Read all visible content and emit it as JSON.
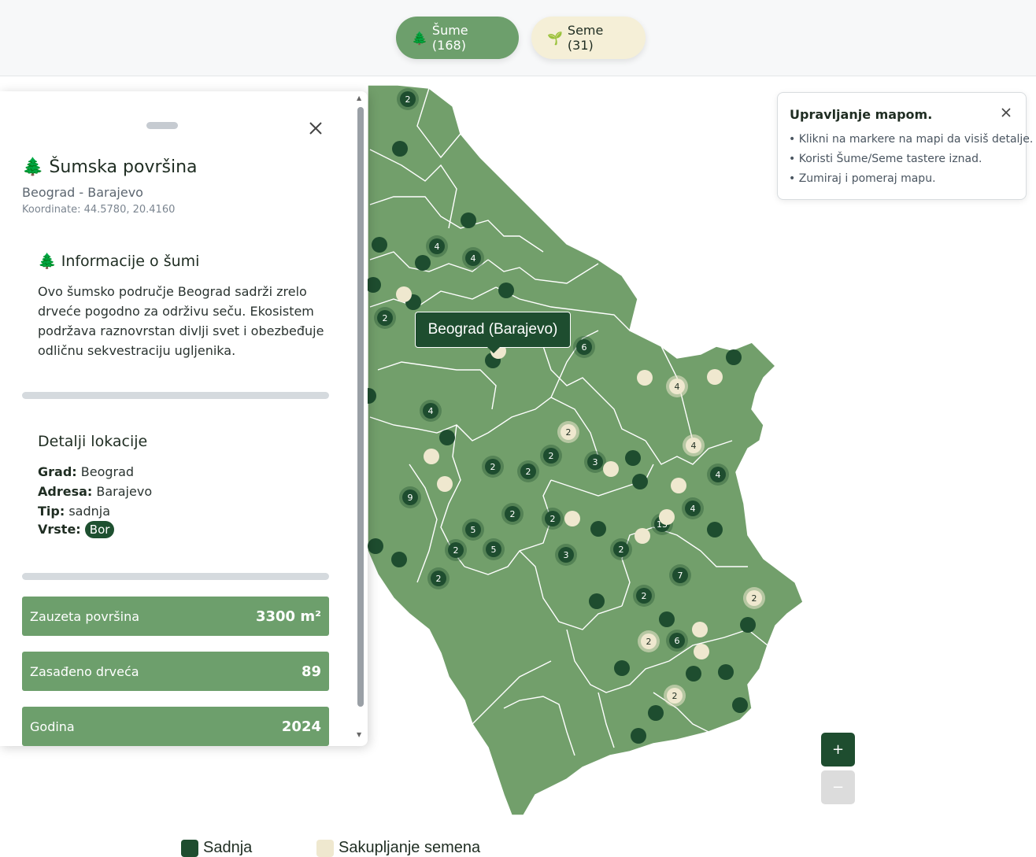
{
  "toolbar": {
    "forests": {
      "icon": "🌲",
      "label": "Šume (168)"
    },
    "seeds": {
      "icon": "🌱",
      "label": "Seme (31)"
    }
  },
  "panel": {
    "title_icon": "🌲",
    "title": "Šumska površina",
    "subtitle": "Beograd - Barajevo",
    "coordinates": "Koordinate: 44.5780, 20.4160",
    "info": {
      "icon": "🌲",
      "title": "Informacije o šumi",
      "text": "Ovo šumsko područje Beograd sadrži zrelo drveće pogodno za održivu seču. Ekosistem podržava raznovrstan divlji svet i obezbeđuje odličnu sekvestraciju ugljenika."
    },
    "location": {
      "title": "Detalji lokacije",
      "city_label": "Grad:",
      "city": "Beograd",
      "address_label": "Adresa:",
      "address": "Barajevo",
      "type_label": "Tip:",
      "type": "sadnja",
      "species_label": "Vrste:",
      "species": "Bor"
    },
    "stats": [
      {
        "label": "Zauzeta površina",
        "value": "3300 m²"
      },
      {
        "label": "Zasađeno drveća",
        "value": "89"
      },
      {
        "label": "Godina",
        "value": "2024"
      }
    ]
  },
  "tooltip": "Beograd (Barajevo)",
  "help": {
    "title": "Upravljanje mapom.",
    "lines": [
      "• Klikni na markere na mapi da visiš detalje.",
      "• Koristi Šume/Seme tastere iznad.",
      "• Zumiraj i pomeraj mapu."
    ]
  },
  "zoom": {
    "in": "+",
    "out": "−"
  },
  "legend": {
    "planting": "Sadnja",
    "seed": "Sakupljanje semena"
  },
  "colors": {
    "map_fill": "#729f6b",
    "planting": "#1e4d2f",
    "seed": "#efe8cf",
    "accent": "#6d9f6c"
  },
  "map_markers": [
    {
      "kind": "planting",
      "count": "2"
    },
    {
      "kind": "planting",
      "count": "4"
    },
    {
      "kind": "planting",
      "count": "4"
    },
    {
      "kind": "planting",
      "count": "2"
    },
    {
      "kind": "planting",
      "count": "6"
    },
    {
      "kind": "seed",
      "count": "4"
    },
    {
      "kind": "seed",
      "count": "2"
    },
    {
      "kind": "seed",
      "count": "4"
    },
    {
      "kind": "planting",
      "count": "4"
    },
    {
      "kind": "planting",
      "count": "2"
    },
    {
      "kind": "planting",
      "count": "2"
    },
    {
      "kind": "planting",
      "count": "3"
    },
    {
      "kind": "planting",
      "count": "2"
    },
    {
      "kind": "planting",
      "count": "9"
    },
    {
      "kind": "planting",
      "count": "4"
    },
    {
      "kind": "planting",
      "count": "2"
    },
    {
      "kind": "planting",
      "count": "2"
    },
    {
      "kind": "planting",
      "count": "4"
    },
    {
      "kind": "planting",
      "count": "13"
    },
    {
      "kind": "planting",
      "count": "5"
    },
    {
      "kind": "planting",
      "count": "5"
    },
    {
      "kind": "planting",
      "count": "2"
    },
    {
      "kind": "planting",
      "count": "3"
    },
    {
      "kind": "planting",
      "count": "2"
    },
    {
      "kind": "planting",
      "count": "2"
    },
    {
      "kind": "planting",
      "count": "7"
    },
    {
      "kind": "planting",
      "count": "2"
    },
    {
      "kind": "seed",
      "count": "2"
    },
    {
      "kind": "seed",
      "count": "2"
    },
    {
      "kind": "planting",
      "count": "6"
    },
    {
      "kind": "seed",
      "count": "2"
    }
  ]
}
